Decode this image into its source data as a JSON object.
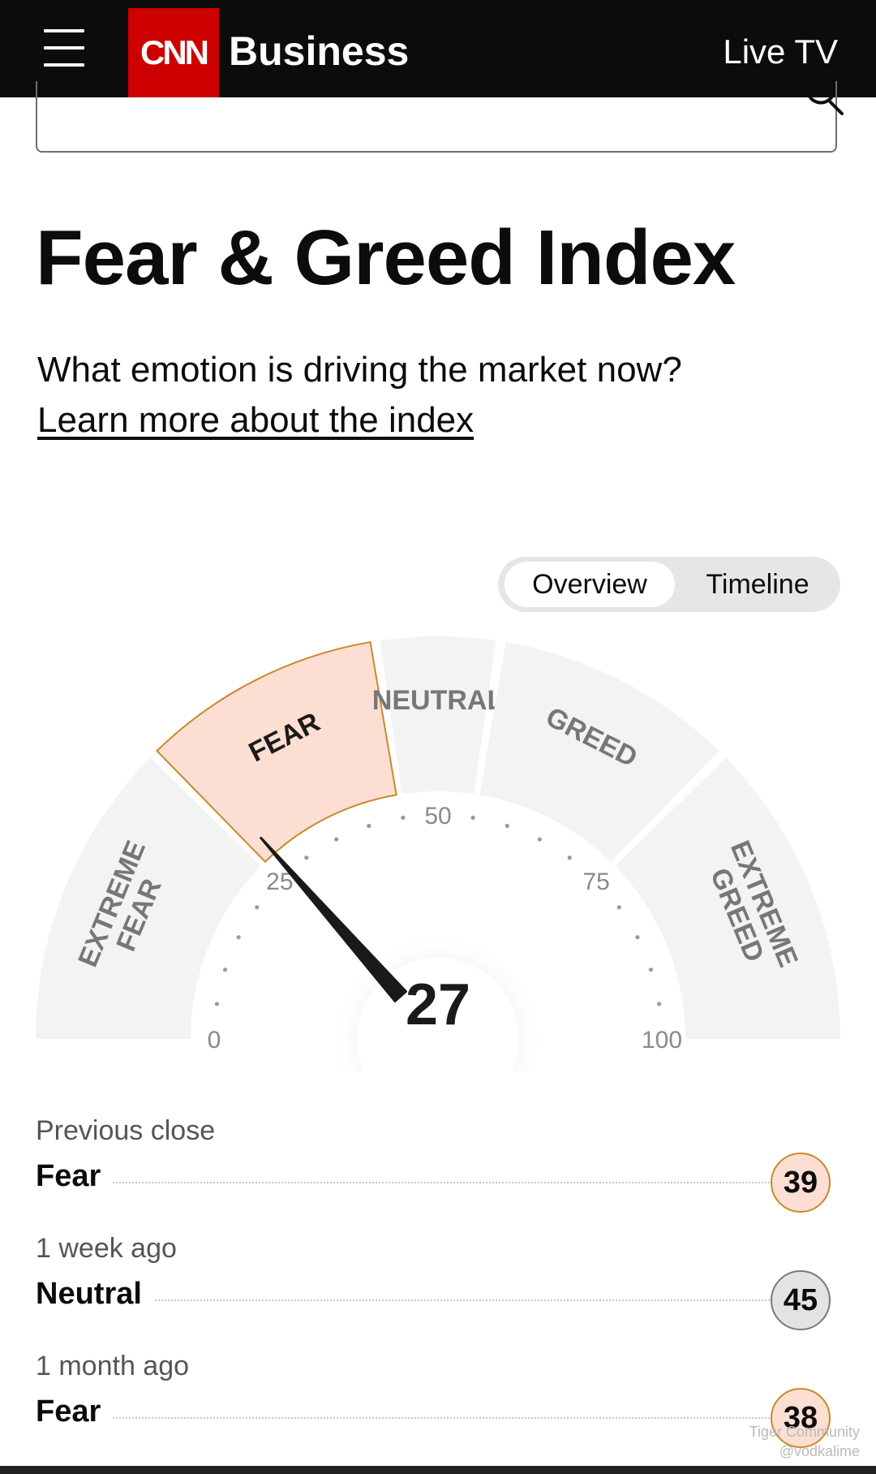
{
  "header": {
    "logo_text": "CNN",
    "section": "Business",
    "live_tv": "Live TV"
  },
  "page": {
    "title": "Fear & Greed Index",
    "subtitle": "What emotion is driving the market now?",
    "learn_more": "Learn more about the index"
  },
  "toggle": {
    "overview": "Overview",
    "timeline": "Timeline",
    "selected": "Overview"
  },
  "gauge": {
    "value": 27,
    "value_text": "27",
    "current_zone": "FEAR",
    "min": 0,
    "max": 100,
    "segments": [
      {
        "label": [
          "EXTREME",
          "FEAR"
        ],
        "from": 0,
        "to": 25
      },
      {
        "label": [
          "FEAR"
        ],
        "from": 25,
        "to": 45
      },
      {
        "label": [
          "NEUTRAL"
        ],
        "from": 45,
        "to": 55
      },
      {
        "label": [
          "GREED"
        ],
        "from": 55,
        "to": 75
      },
      {
        "label": [
          "EXTREME",
          "GREED"
        ],
        "from": 75,
        "to": 100
      }
    ],
    "ticks": [
      "0",
      "25",
      "50",
      "75",
      "100"
    ],
    "colors": {
      "active_fill": "#fcded2",
      "active_stroke": "#c98a2d",
      "inactive_fill": "#f3f3f3",
      "needle": "#1a1a1a"
    }
  },
  "history": [
    {
      "label": "Previous close",
      "status": "Fear",
      "value": "39",
      "kind": "fear"
    },
    {
      "label": "1 week ago",
      "status": "Neutral",
      "value": "45",
      "kind": "neutral"
    },
    {
      "label": "1 month ago",
      "status": "Fear",
      "value": "38",
      "kind": "fear"
    }
  ],
  "watermark": {
    "line1": "Tiger Community",
    "line2": "@vodkalime"
  }
}
